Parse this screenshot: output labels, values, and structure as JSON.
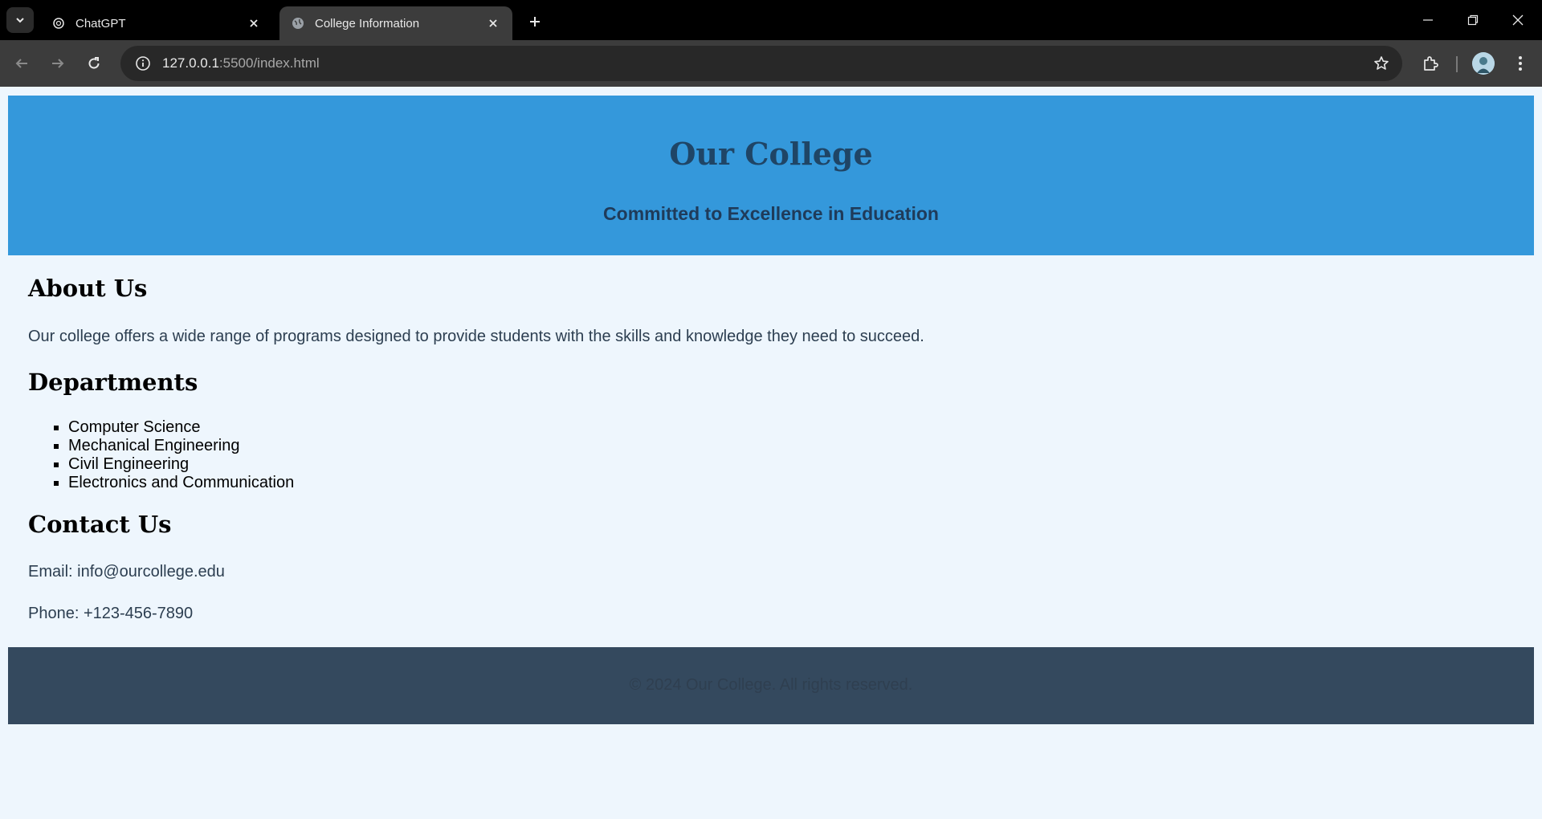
{
  "browser": {
    "tabs": [
      {
        "title": "ChatGPT",
        "favicon": "chatgpt-icon",
        "active": false
      },
      {
        "title": "College Information",
        "favicon": "globe-icon",
        "active": true
      }
    ],
    "url": {
      "host": "127.0.0.1",
      "path": ":5500/index.html"
    },
    "colors": {
      "chrome_bg": "#000000",
      "toolbar_bg": "#3c3c3c",
      "omnibox_bg": "#282828"
    }
  },
  "page": {
    "header": {
      "title": "Our College",
      "subtitle": "Committed to Excellence in Education"
    },
    "about": {
      "heading": "About Us",
      "text": "Our college offers a wide range of programs designed to provide students with the skills and knowledge they need to succeed."
    },
    "departments": {
      "heading": "Departments",
      "items": [
        "Computer Science",
        "Mechanical Engineering",
        "Civil Engineering",
        "Electronics and Communication"
      ]
    },
    "contact": {
      "heading": "Contact Us",
      "email": "Email: info@ourcollege.edu",
      "phone": "Phone: +123-456-7890"
    },
    "footer": {
      "text": "© 2024 Our College. All rights reserved."
    },
    "colors": {
      "header_bg": "#3498db",
      "page_bg": "#eef6fd",
      "footer_bg": "#34495e"
    }
  }
}
